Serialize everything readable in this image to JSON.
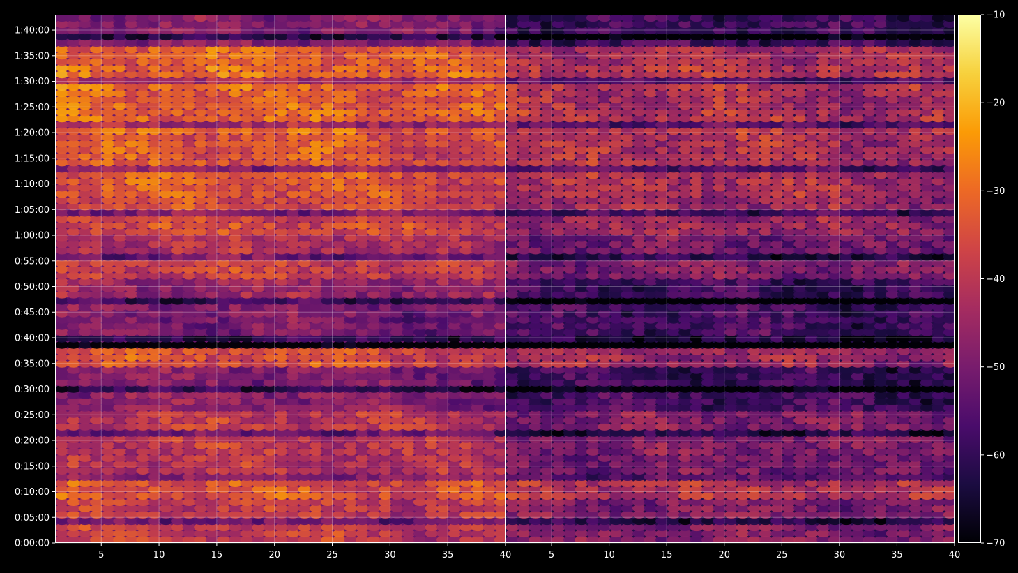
{
  "chart_data": {
    "type": "heatmap",
    "background": "#000000",
    "colormap": "inferno",
    "colormap_stops": [
      "#000004",
      "#1b0c41",
      "#4a0c6b",
      "#781c6d",
      "#a52c60",
      "#cf4446",
      "#ed6925",
      "#fb9b06",
      "#f7d13d",
      "#fcffa4"
    ],
    "grid": true,
    "x_range": [
      1,
      40
    ],
    "x_ticks": [
      5,
      10,
      15,
      20,
      25,
      30,
      35,
      40
    ],
    "y_range_seconds": [
      0,
      6180
    ],
    "y_tick_labels": [
      "0:00:00",
      "0:05:00",
      "0:10:00",
      "0:15:00",
      "0:20:00",
      "0:25:00",
      "0:30:00",
      "0:35:00",
      "0:40:00",
      "0:45:00",
      "0:50:00",
      "0:55:00",
      "1:00:00",
      "1:05:00",
      "1:10:00",
      "1:15:00",
      "1:20:00",
      "1:25:00",
      "1:30:00",
      "1:35:00",
      "1:40:00"
    ],
    "colorbar": {
      "range": [
        -70,
        -10
      ],
      "ticks": [
        "−10",
        "−20",
        "−30",
        "−40",
        "−50",
        "−60",
        "−70"
      ]
    },
    "panels": [
      {
        "name": "left",
        "x_ticks_shown": [
          "5",
          "10",
          "15",
          "20",
          "25",
          "30",
          "35",
          "40"
        ],
        "mean_level": -36,
        "band_means_by_time_min": [
          [
            0,
            8,
            -38
          ],
          [
            8,
            13,
            -33
          ],
          [
            13,
            17,
            -40
          ],
          [
            17,
            26,
            -39
          ],
          [
            26,
            31,
            -47
          ],
          [
            31,
            34,
            -48
          ],
          [
            34,
            38,
            -34
          ],
          [
            38,
            41,
            -60
          ],
          [
            41,
            46,
            -49
          ],
          [
            46,
            52,
            -45
          ],
          [
            52,
            56,
            -37
          ],
          [
            56,
            60,
            -41
          ],
          [
            60,
            68,
            -35
          ],
          [
            68,
            80,
            -33
          ],
          [
            80,
            85,
            -30
          ],
          [
            85,
            88,
            -31
          ],
          [
            88,
            93,
            -29
          ],
          [
            93,
            97,
            -31
          ],
          [
            97,
            103,
            -48
          ]
        ]
      },
      {
        "name": "right",
        "x_ticks_shown": [
          "5",
          "10",
          "15",
          "20",
          "25",
          "30",
          "35",
          "40"
        ],
        "mean_level": -46,
        "band_means_by_time_min": [
          [
            0,
            8,
            -48
          ],
          [
            8,
            13,
            -40
          ],
          [
            13,
            17,
            -50
          ],
          [
            17,
            26,
            -48
          ],
          [
            26,
            31,
            -57
          ],
          [
            31,
            34,
            -58
          ],
          [
            34,
            38,
            -44
          ],
          [
            38,
            41,
            -64
          ],
          [
            41,
            46,
            -57
          ],
          [
            46,
            52,
            -58
          ],
          [
            52,
            56,
            -48
          ],
          [
            56,
            60,
            -50
          ],
          [
            60,
            68,
            -44
          ],
          [
            68,
            80,
            -41
          ],
          [
            80,
            85,
            -40
          ],
          [
            85,
            88,
            -42
          ],
          [
            88,
            93,
            -40
          ],
          [
            93,
            97,
            -42
          ],
          [
            97,
            103,
            -58
          ]
        ]
      }
    ]
  }
}
